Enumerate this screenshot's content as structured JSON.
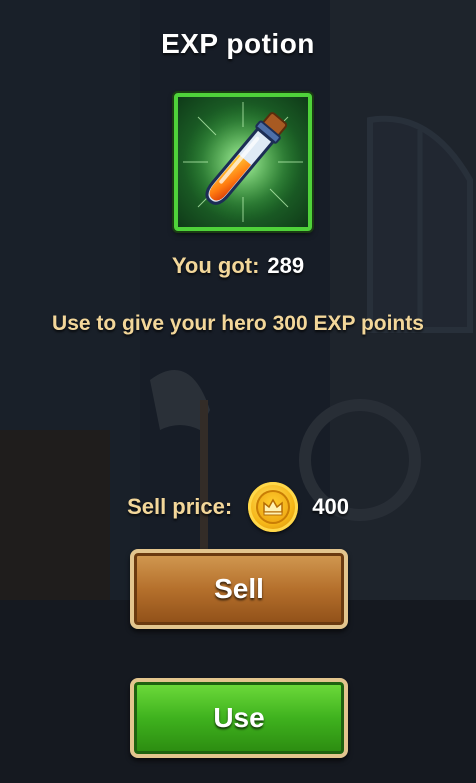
{
  "item": {
    "title": "EXP potion",
    "icon": "exp-potion-icon"
  },
  "got": {
    "label": "You got:",
    "value": "289"
  },
  "description": "Use to give your hero 300 EXP points",
  "price": {
    "label": "Sell price:",
    "icon": "gold-crown-coin-icon",
    "value": "400"
  },
  "buttons": {
    "sell": "Sell",
    "use": "Use"
  },
  "colors": {
    "label_gold": "#f3d79a",
    "frame_green": "#4fd23a",
    "sell_brown": "#b5702c",
    "use_green": "#3fb21e"
  }
}
